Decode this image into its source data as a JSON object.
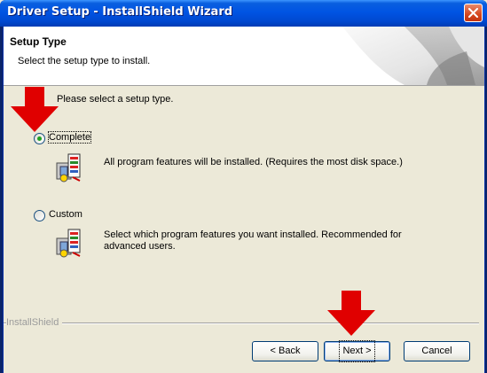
{
  "window": {
    "title": "Driver Setup - InstallShield Wizard",
    "close_icon": "close-x-icon"
  },
  "header": {
    "title": "Setup Type",
    "subtitle": "Select the setup type to install."
  },
  "prompt": "Please select a setup type.",
  "options": [
    {
      "label": "Complete",
      "selected": true,
      "description": "All program features will be installed. (Requires the most disk space.)",
      "icon": "setup-package-icon"
    },
    {
      "label": "Custom",
      "selected": false,
      "description": "Select which program features you want installed. Recommended for advanced users.",
      "icon": "setup-package-icon"
    }
  ],
  "footer": {
    "brand": "InstallShield",
    "buttons": {
      "back": "< Back",
      "next": "Next >",
      "cancel": "Cancel"
    }
  },
  "colors": {
    "title_bar": "#0054e3",
    "annotation_arrow": "#e00000",
    "radio_dot": "#21a121"
  }
}
